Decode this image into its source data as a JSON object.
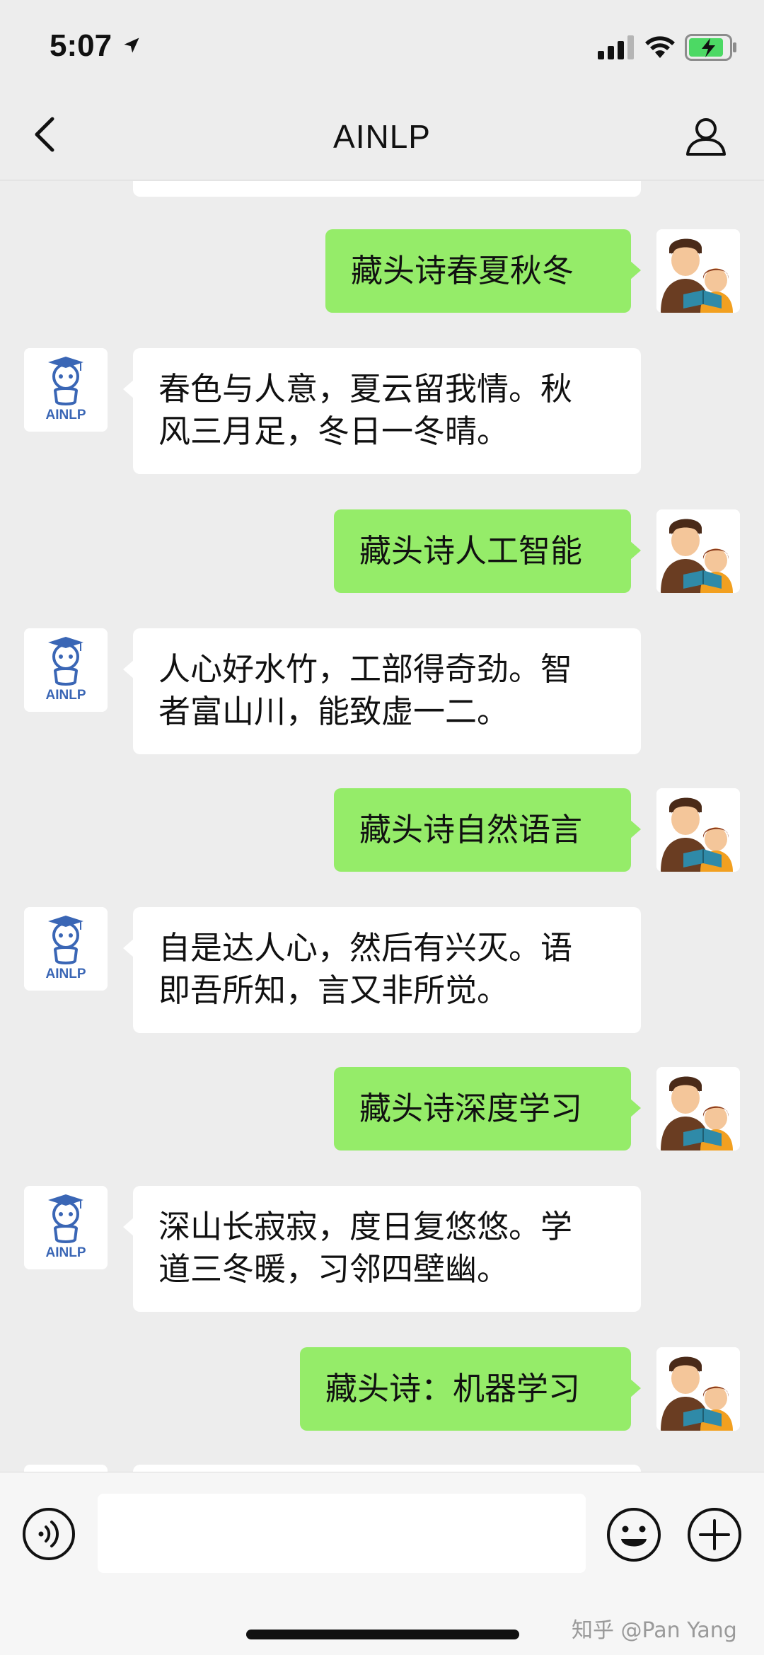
{
  "status_bar": {
    "time": "5:07",
    "icons": [
      "location-arrow-icon",
      "cellular-signal-icon",
      "wifi-icon",
      "battery-charging-icon"
    ]
  },
  "nav": {
    "title": "AINLP",
    "back_icon": "chevron-left-icon",
    "profile_icon": "person-outline-icon"
  },
  "bot": {
    "avatar_label": "AINLP",
    "accent_color": "#3a66b5"
  },
  "messages": [
    {
      "from": "me",
      "text": "藏头诗春夏秋冬"
    },
    {
      "from": "bot",
      "text": "春色与人意，夏云留我情。秋\n风三月足，冬日一冬晴。"
    },
    {
      "from": "me",
      "text": "藏头诗人工智能"
    },
    {
      "from": "bot",
      "text": "人心好水竹，工部得奇劲。智\n者富山川，能致虚一二。"
    },
    {
      "from": "me",
      "text": "藏头诗自然语言"
    },
    {
      "from": "bot",
      "text": "自是达人心，然后有兴灭。语\n即吾所知，言又非所觉。"
    },
    {
      "from": "me",
      "text": "藏头诗深度学习"
    },
    {
      "from": "bot",
      "text": "深山长寂寂，度日复悠悠。学\n道三冬暖，习邻四壁幽。"
    },
    {
      "from": "me",
      "text": "藏头诗：机器学习"
    }
  ],
  "colors": {
    "outgoing_bubble": "#95ec69",
    "incoming_bubble": "#ffffff",
    "background": "#ededed"
  },
  "input_bar": {
    "voice_icon": "voice-input-icon",
    "emoji_icon": "emoji-icon",
    "plus_icon": "plus-circle-icon",
    "input_value": ""
  },
  "watermark": "知乎 @Pan Yang"
}
